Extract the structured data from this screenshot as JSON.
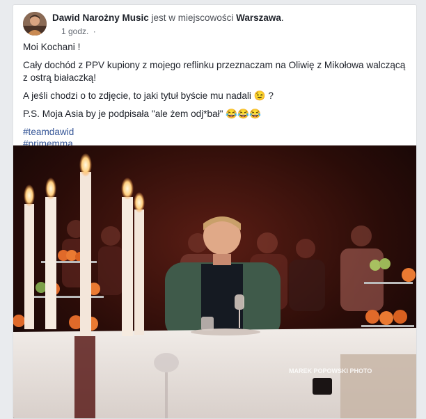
{
  "post": {
    "author_name": "Dawid Narożny Music",
    "location_prefix": "jest w miejscowości",
    "location": "Warszawa",
    "time": "1 godz.",
    "privacy_icon": "public-icon",
    "paragraphs": [
      "Moi Kochani !",
      "Cały dochód z PPV kupiony z mojego reflinku przeznaczam na Oliwię z Mikołowa walczącą z ostrą białaczką!",
      "A jeśli chodzi o to zdjęcie,  to jaki tytuł byście mu nadali 😉 ?",
      "P.S. Moja Asia by je podpisała \"ale żem odj*bał\" 😂😂😂"
    ],
    "hashtags": [
      "#teamdawid",
      "#primemma"
    ],
    "photo_watermark": "MAREK POPOWSKI PHOTO"
  },
  "colors": {
    "link": "#385898",
    "text": "#1d2129",
    "secondary": "#616770"
  }
}
